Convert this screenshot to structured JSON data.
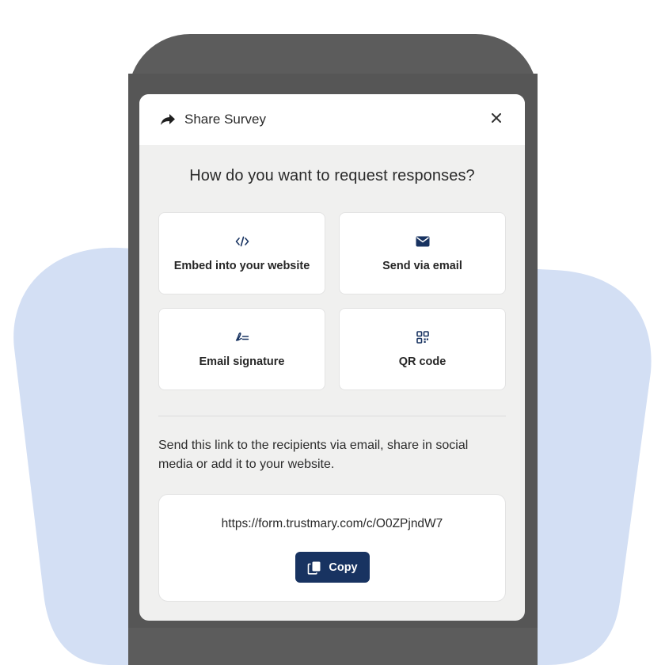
{
  "modal": {
    "title": "Share Survey",
    "question": "How do you want to request responses?",
    "options": [
      {
        "label": "Embed into your website",
        "icon": "code-icon"
      },
      {
        "label": "Send via email",
        "icon": "envelope-icon"
      },
      {
        "label": "Email signature",
        "icon": "signature-icon"
      },
      {
        "label": "QR code",
        "icon": "qr-code-icon"
      }
    ],
    "instructions": "Send this link to the recipients via email, share in social media or add it to your website.",
    "link": {
      "url": "https://form.trustmary.com/c/O0ZPjndW7",
      "copy_label": "Copy"
    }
  },
  "colors": {
    "accent": "#183361",
    "modal_background": "#f0f0ef",
    "phone_frame": "#5c5c5c",
    "blob": "#d3dff4"
  }
}
